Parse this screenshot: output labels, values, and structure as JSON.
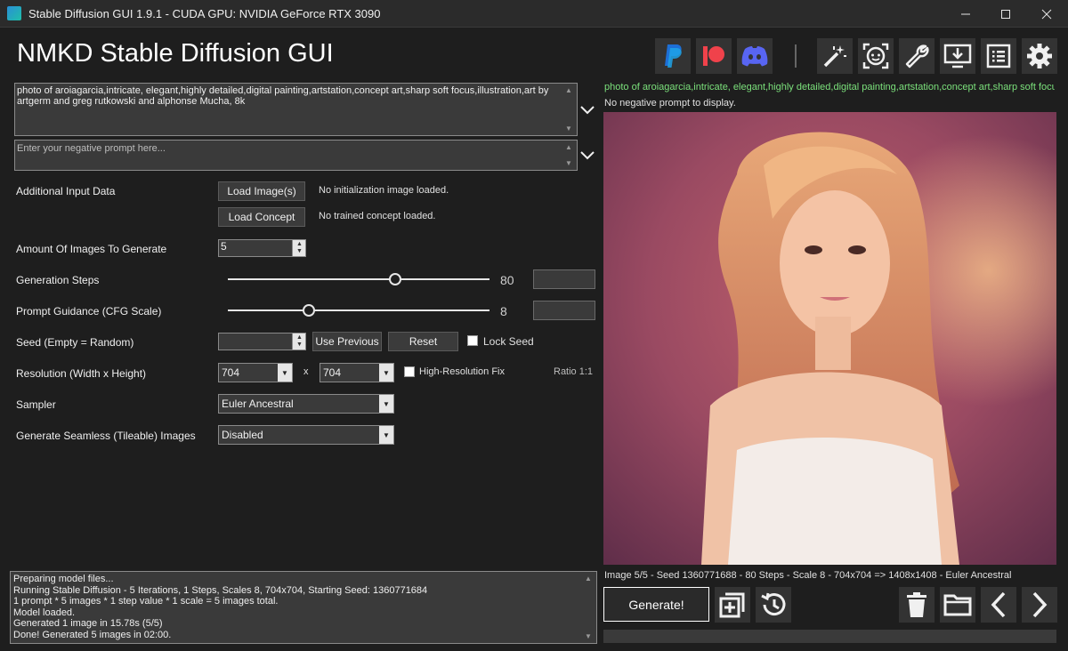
{
  "window": {
    "title": "Stable Diffusion GUI 1.9.1 - CUDA GPU: NVIDIA GeForce RTX 3090",
    "controls": [
      "minimize",
      "maximize",
      "close"
    ]
  },
  "app": {
    "title": "NMKD Stable Diffusion GUI",
    "toolbar_icons": [
      "paypal-icon",
      "patreon-icon",
      "discord-icon",
      "magic-wand-icon",
      "face-restore-icon",
      "wrench-icon",
      "download-icon",
      "list-icon",
      "gear-icon"
    ]
  },
  "prompt": {
    "text": "photo of aroiagarcia,intricate, elegant,highly detailed,digital painting,artstation,concept art,sharp soft focus,illustration,art by artgerm and greg rutkowski and alphonse Mucha, 8k",
    "negative_placeholder": "Enter your negative prompt here..."
  },
  "settings": {
    "additional_input_label": "Additional Input Data",
    "load_image_label": "Load Image(s)",
    "no_init_image": "No initialization image loaded.",
    "load_concept_label": "Load Concept",
    "no_concept": "No trained concept loaded.",
    "amount_label": "Amount Of Images To Generate",
    "amount_value": "5",
    "steps_label": "Generation Steps",
    "steps_value": "80",
    "steps_fraction": 0.64,
    "cfg_label": "Prompt Guidance (CFG Scale)",
    "cfg_value": "8",
    "cfg_fraction": 0.31,
    "seed_label": "Seed (Empty = Random)",
    "seed_value": "",
    "use_previous_label": "Use Previous",
    "reset_label": "Reset",
    "lock_seed_label": "Lock Seed",
    "resolution_label": "Resolution (Width x Height)",
    "width_value": "704",
    "x_label": "x",
    "height_value": "704",
    "hires_label": "High-Resolution Fix",
    "ratio_label": "Ratio 1:1",
    "sampler_label": "Sampler",
    "sampler_value": "Euler Ancestral",
    "seamless_label": "Generate Seamless (Tileable) Images",
    "seamless_value": "Disabled"
  },
  "preview": {
    "prompt_info": "photo of aroiagarcia,intricate, elegant,highly detailed,digital painting,artstation,concept art,sharp soft focus...",
    "negative_info": "No negative prompt to display.",
    "image_info": "Image 5/5  - Seed 1360771688 - 80 Steps - Scale 8 - 704x704 => 1408x1408 - Euler Ancestral",
    "generate_label": "Generate!"
  },
  "log": {
    "lines": [
      "Preparing model files...",
      "Running Stable Diffusion - 5 Iterations, 1 Steps, Scales 8, 704x704, Starting Seed: 1360771684",
      "1 prompt * 5 images * 1 step value * 1 scale = 5 images total.",
      "Model loaded.",
      "Generated 1 image in 15.78s (5/5)",
      "Done! Generated 5 images in 02:00."
    ]
  },
  "colors": {
    "background": "#1e1e1e",
    "prompt_info_green": "#7be07b",
    "paypal_blue": "#1d6fd6",
    "patreon_red": "#f0424b",
    "discord_blurple": "#5865f2"
  }
}
